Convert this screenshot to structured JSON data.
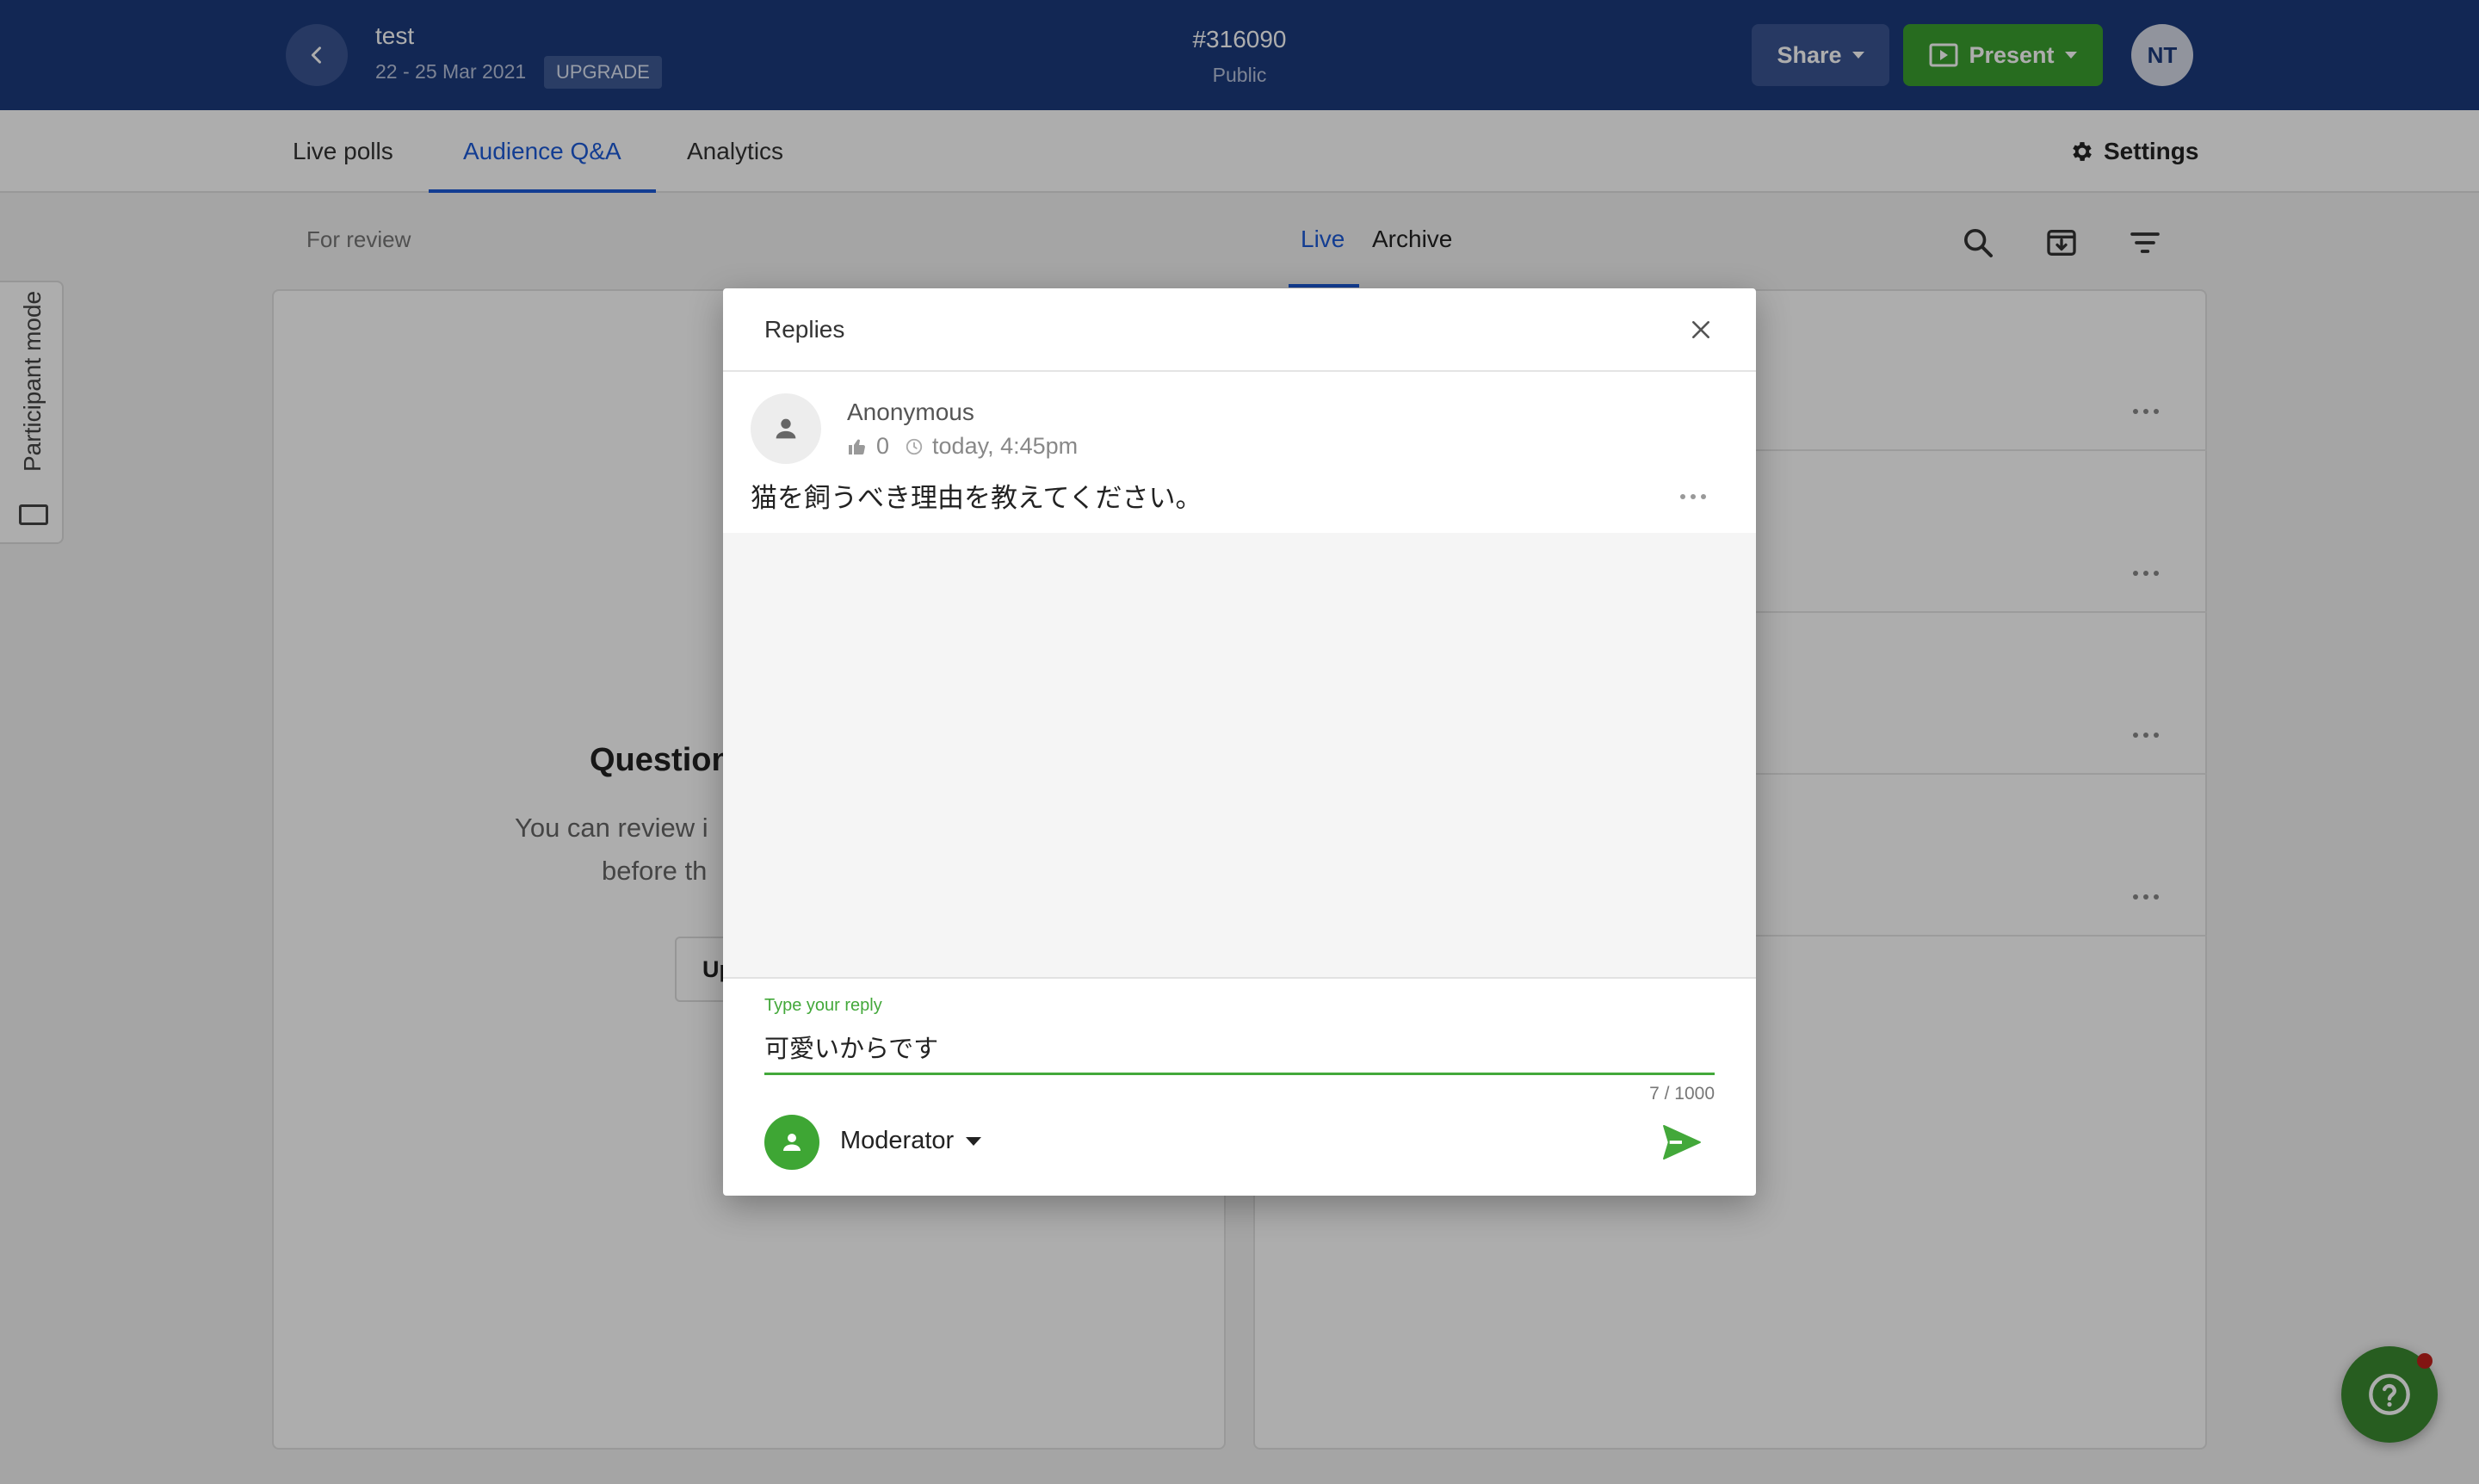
{
  "header": {
    "event_title": "test",
    "event_dates": "22 - 25 Mar 2021",
    "upgrade_label": "UPGRADE",
    "event_code": "#316090",
    "event_visibility": "Public",
    "share_label": "Share",
    "present_label": "Present",
    "user_initials": "NT"
  },
  "nav": {
    "tabs": [
      {
        "label": "Live polls"
      },
      {
        "label": "Audience Q&A",
        "active": true
      },
      {
        "label": "Analytics"
      }
    ],
    "settings_label": "Settings"
  },
  "toolbar": {
    "for_review_label": "For review",
    "live_label": "Live",
    "archive_label": "Archive"
  },
  "side_tab": {
    "label": "Participant mode"
  },
  "left_panel": {
    "empty_title": "Question",
    "empty_desc_line1": "You can review i",
    "empty_desc_line2": "before th",
    "button_label": "Up"
  },
  "modal": {
    "title": "Replies",
    "question": {
      "author": "Anonymous",
      "likes": "0",
      "time": "today, 4:45pm",
      "text": "猫を飼うべき理由を教えてください。"
    },
    "reply": {
      "label": "Type your reply",
      "value": "可愛いからです",
      "char_count": "7 / 1000"
    },
    "author_select": "Moderator"
  },
  "colors": {
    "header_bg": "#1b3a7c",
    "accent_blue": "#1d5bd8",
    "accent_green": "#43a83a",
    "present_green": "#3a9f2f",
    "notification_red": "#c0201b"
  }
}
